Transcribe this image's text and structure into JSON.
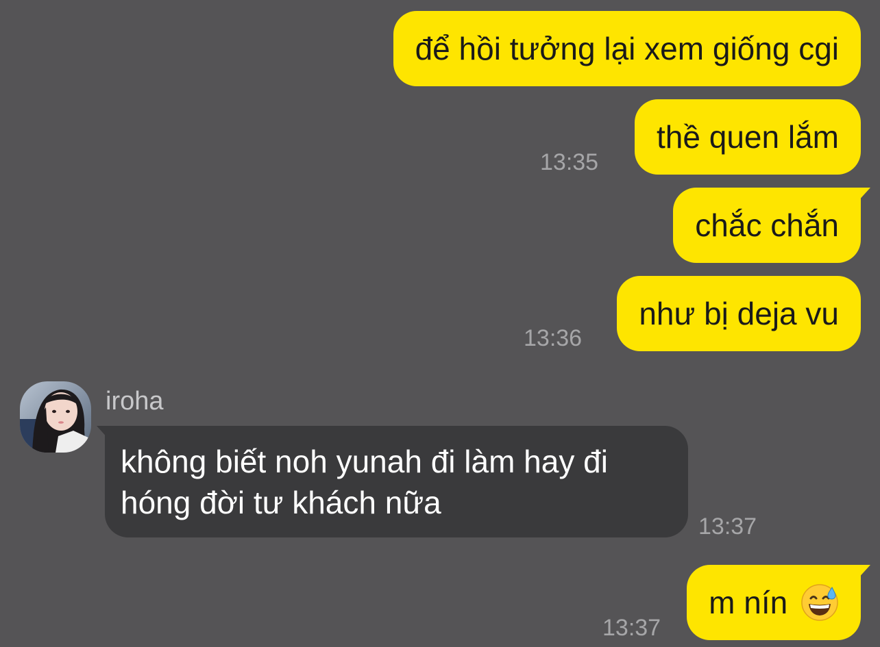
{
  "sender": {
    "name": "iroha",
    "avatar": "profile-photo"
  },
  "messages": [
    {
      "text": "để hồi tưởng lại xem giống cgi",
      "from": "me",
      "time": ""
    },
    {
      "text": "thề quen lắm",
      "from": "me",
      "time": "13:35"
    },
    {
      "text": "chắc chắn",
      "from": "me",
      "time": ""
    },
    {
      "text": "như bị deja vu",
      "from": "me",
      "time": "13:36"
    },
    {
      "text": "không biết noh yunah đi làm hay đi hóng đời tư khách nữa",
      "from": "iroha",
      "time": "13:37"
    },
    {
      "text": "m nín",
      "emoji": "grinning-face-with-sweat",
      "from": "me",
      "time": "13:37"
    }
  ],
  "colors": {
    "background": "#555456",
    "my_bubble": "#fee500",
    "their_bubble": "#3a3a3c",
    "timestamp": "#a6a6a8"
  }
}
